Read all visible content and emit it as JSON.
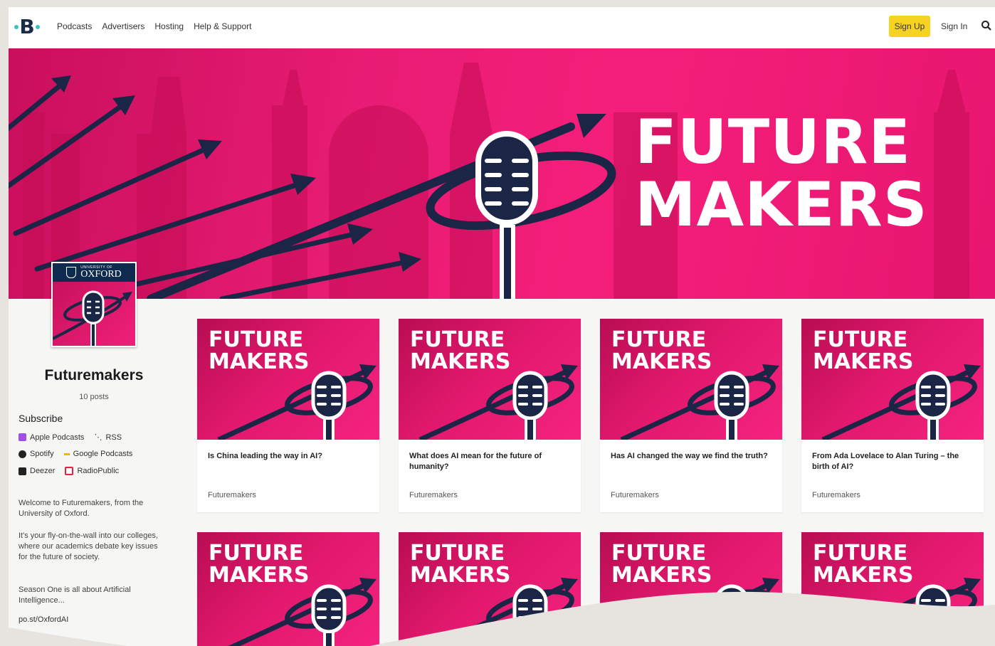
{
  "nav": {
    "logo": "B",
    "links": [
      "Podcasts",
      "Advertisers",
      "Hosting",
      "Help & Support"
    ],
    "signup": "Sign Up",
    "signin": "Sign In"
  },
  "banner": {
    "line1": "FUTURE",
    "line2": "MAKERS"
  },
  "show": {
    "logo_text": "OXFORD",
    "logo_caption": "UNIVERSITY OF",
    "title": "Futuremakers",
    "posts": "10 posts",
    "subscribe_label": "Subscribe",
    "platforms": [
      {
        "name": "Apple Podcasts",
        "color": "#a14ee6"
      },
      {
        "name": "RSS",
        "color": "#333333"
      },
      {
        "name": "Spotify",
        "color": "#222222"
      },
      {
        "name": "Google Podcasts",
        "color": "#f5b400"
      },
      {
        "name": "Deezer",
        "color": "#222222"
      },
      {
        "name": "RadioPublic",
        "color": "#e0243f"
      }
    ],
    "description": [
      "Welcome to Futuremakers, from the University of Oxford.",
      "It's your fly-on-the-wall into our colleges, where our academics debate key issues for the future of society.",
      "Season One is all about Artificial Intelligence...",
      "po.st/OxfordAI"
    ]
  },
  "episodes": [
    {
      "art_line1": "FUTURE",
      "art_line2": "MAKERS",
      "title": "Is China leading the way in AI?",
      "show": "Futuremakers"
    },
    {
      "art_line1": "FUTURE",
      "art_line2": "MAKERS",
      "title": "What does AI mean for the future of humanity?",
      "show": "Futuremakers"
    },
    {
      "art_line1": "FUTURE",
      "art_line2": "MAKERS",
      "title": "Has AI changed the way we find the truth?",
      "show": "Futuremakers"
    },
    {
      "art_line1": "FUTURE",
      "art_line2": "MAKERS",
      "title": "From Ada Lovelace to Alan Turing – the birth of AI?",
      "show": "Futuremakers"
    },
    {
      "art_line1": "FUTURE",
      "art_line2": "MAKERS"
    },
    {
      "art_line1": "FUTURE",
      "art_line2": "MAKERS"
    },
    {
      "art_line1": "FUTURE",
      "art_line2": "MAKERS"
    },
    {
      "art_line1": "FUTURE",
      "art_line2": "MAKERS"
    }
  ],
  "colors": {
    "brand_pink": "#e81c74",
    "navy": "#1a2b4a",
    "signup_yellow": "#f5d320"
  }
}
